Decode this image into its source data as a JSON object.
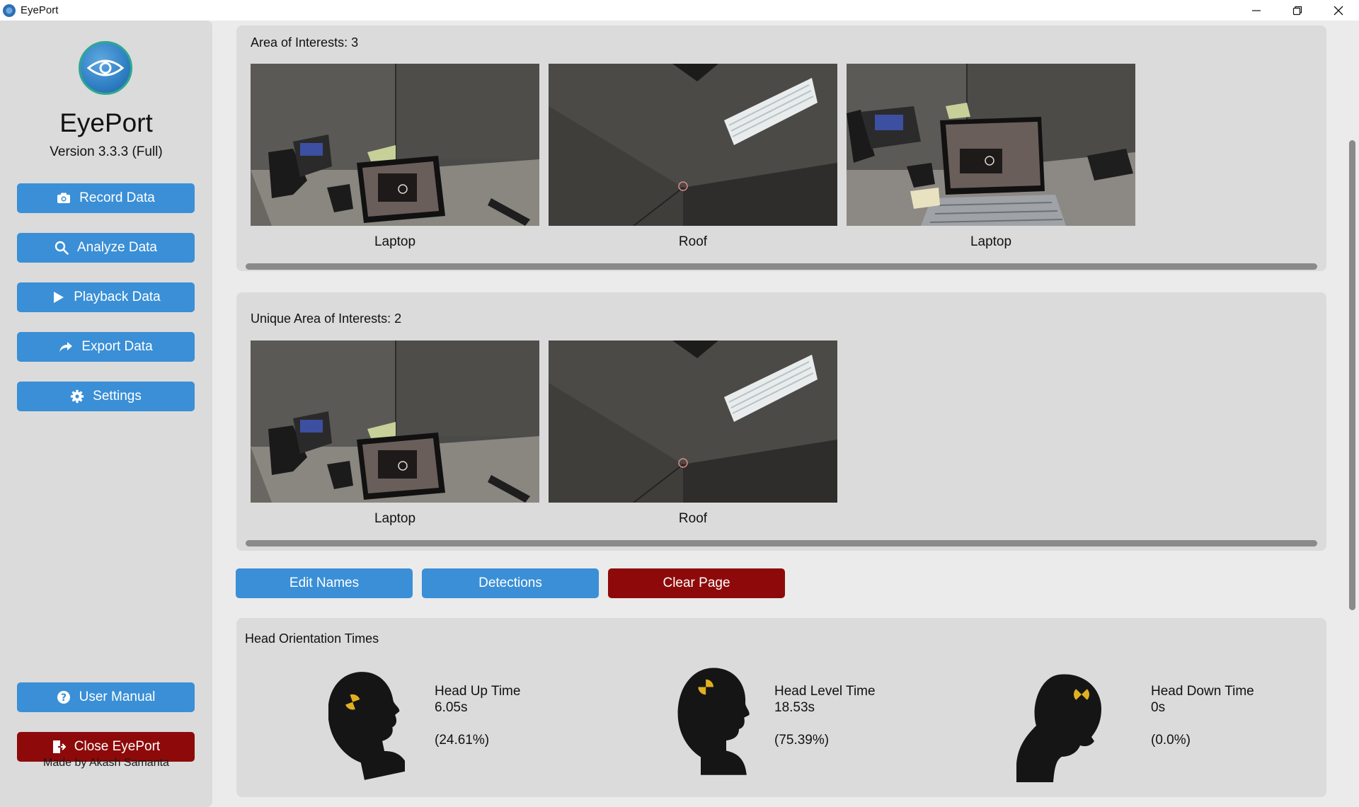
{
  "window": {
    "title": "EyePort"
  },
  "sidebar": {
    "app_name": "EyePort",
    "version": "Version 3.3.3 (Full)",
    "buttons": [
      {
        "label": "Record Data",
        "icon": "camera-icon"
      },
      {
        "label": "Analyze Data",
        "icon": "search-icon"
      },
      {
        "label": "Playback Data",
        "icon": "play-icon"
      },
      {
        "label": "Export Data",
        "icon": "share-icon"
      },
      {
        "label": "Settings",
        "icon": "gear-icon"
      }
    ],
    "user_manual": "User Manual",
    "close": "Close EyePort",
    "credit": "Made by Akash Samanta"
  },
  "aoi": {
    "title": "Area of Interests: 3",
    "items": [
      {
        "label": "Laptop",
        "scene": "desk-laptop"
      },
      {
        "label": "Roof",
        "scene": "ceiling-light"
      },
      {
        "label": "Laptop",
        "scene": "desk-laptop-keyboard"
      }
    ]
  },
  "unique_aoi": {
    "title": "Unique Area of Interests: 2",
    "items": [
      {
        "label": "Laptop",
        "scene": "desk-laptop"
      },
      {
        "label": "Roof",
        "scene": "ceiling-light"
      }
    ]
  },
  "actions": {
    "edit_names": "Edit Names",
    "detections": "Detections",
    "clear_page": "Clear Page"
  },
  "head": {
    "title": "Head Orientation Times",
    "up": {
      "label": "Head Up Time",
      "time": "6.05s",
      "percent": "(24.61%)"
    },
    "level": {
      "label": "Head Level Time",
      "time": "18.53s",
      "percent": "(75.39%)"
    },
    "down": {
      "label": "Head Down Time",
      "time": "0s",
      "percent": "(0.0%)"
    }
  },
  "colors": {
    "accent": "#3a8fd6",
    "danger": "#8e0a0a",
    "crash_marker": "#e0b020"
  }
}
